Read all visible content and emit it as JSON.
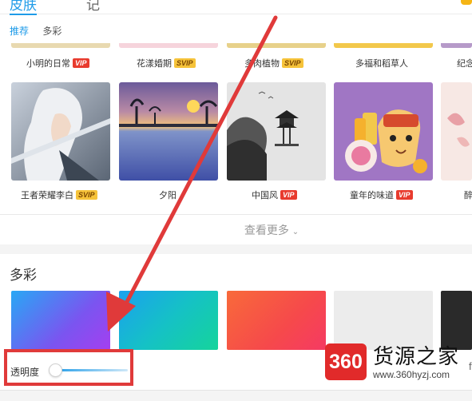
{
  "header": {
    "tabs": [
      "皮肤",
      "记"
    ]
  },
  "subtabs": [
    "推荐",
    "多彩"
  ],
  "row1": {
    "items": [
      {
        "name": "小明的日常",
        "badge": "VIP"
      },
      {
        "name": "花漾婚期",
        "badge": "SVIP"
      },
      {
        "name": "多肉植物",
        "badge": "SVIP"
      },
      {
        "name": "多福和稻草人",
        "badge": ""
      },
      {
        "name": "纪念",
        "badge": ""
      }
    ]
  },
  "row2": {
    "items": [
      {
        "name": "王者荣耀李白",
        "badge": "SVIP"
      },
      {
        "name": "夕阳",
        "badge": ""
      },
      {
        "name": "中国风",
        "badge": "VIP"
      },
      {
        "name": "童年的味道",
        "badge": "VIP"
      },
      {
        "name": "醉",
        "badge": ""
      }
    ]
  },
  "see_more": "查看更多",
  "section_title": "多彩",
  "opacity": {
    "label": "透明度",
    "value_fraction": 0.0
  },
  "watermark": {
    "logo": "360",
    "name": "货源之家",
    "url": "www.360hyzj.com"
  },
  "right_edge_text": "fl",
  "colors": {
    "accent": "#1e9be8",
    "arrow": "#e03a3a",
    "vip": "#e83b2e",
    "svip": "#f6c33a"
  }
}
